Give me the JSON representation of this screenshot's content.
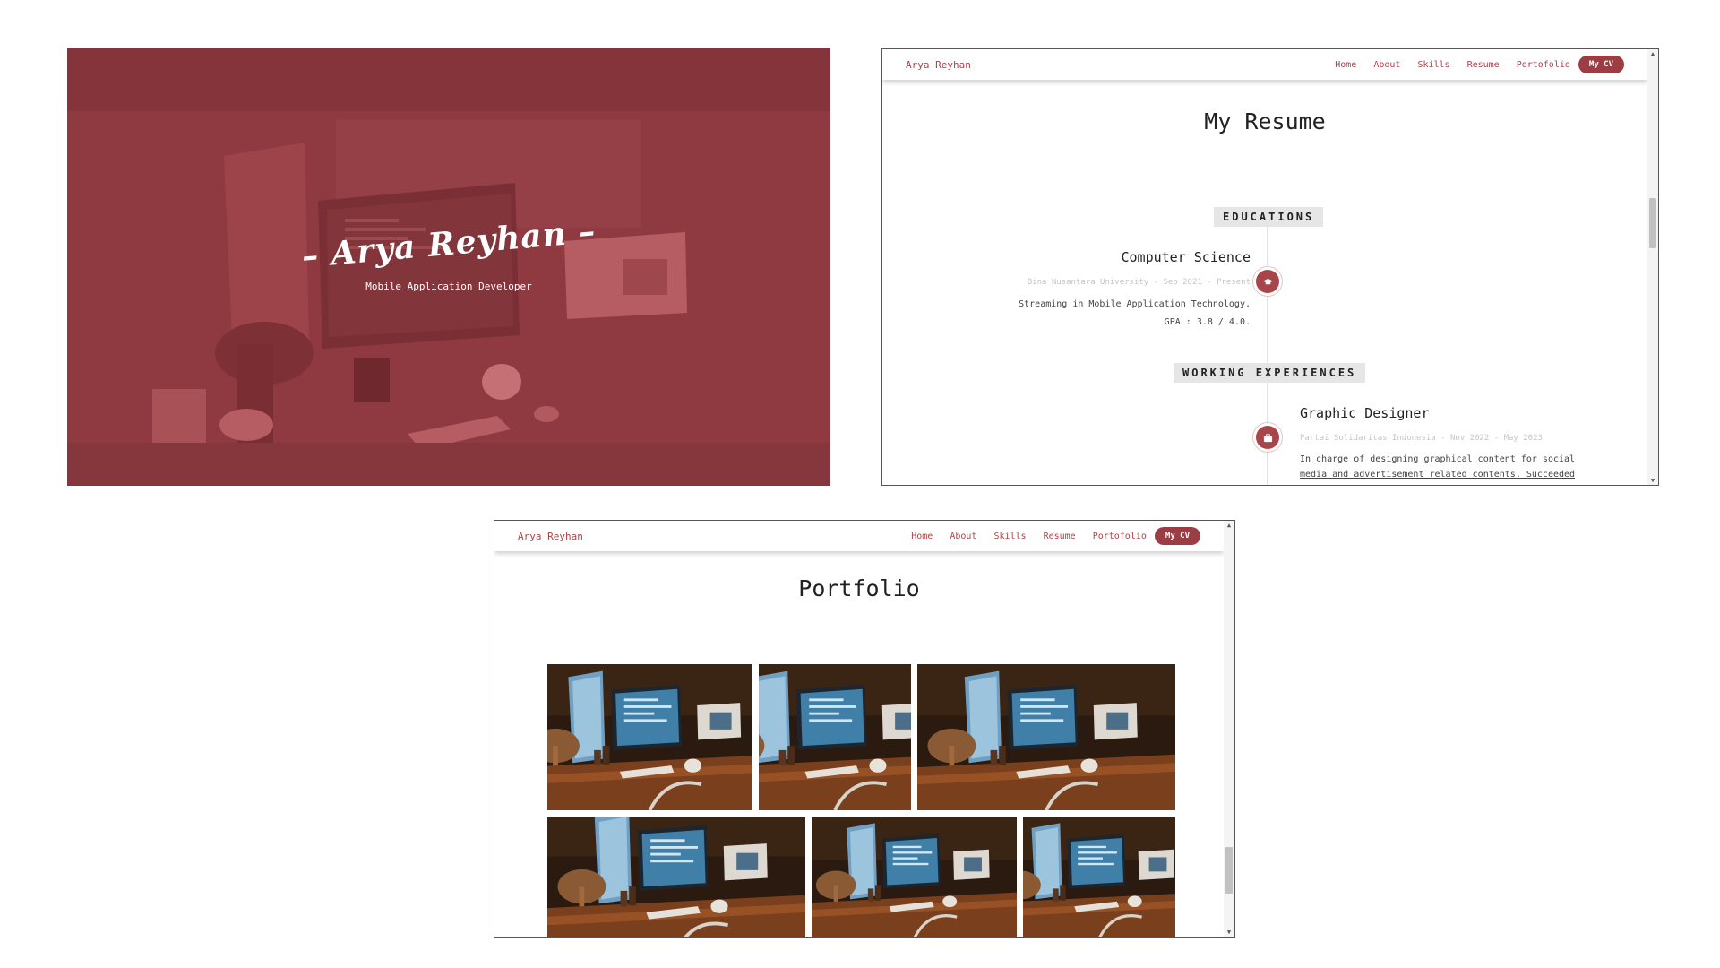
{
  "hero": {
    "title": "– Arya Reyhan –",
    "subtitle": "Mobile Application Developer",
    "overlay_color": "#8f3a41"
  },
  "nav": {
    "brand": "Arya Reyhan",
    "links": [
      "Home",
      "About",
      "Skills",
      "Resume",
      "Portofolio"
    ],
    "cv_button": "My CV",
    "accent_color": "#a8454b"
  },
  "resume": {
    "title": "My Resume",
    "educations": {
      "heading": "EDUCATIONS",
      "item": {
        "title": "Computer Science",
        "meta": "Bina Nusantara University - Sep 2021 - Present",
        "desc_line1": "Streaming in Mobile Application Technology.",
        "desc_line2": "GPA : 3.8 / 4.0.",
        "icon": "graduation-cap-icon"
      }
    },
    "experiences": {
      "heading": "WORKING EXPERIENCES",
      "item": {
        "title": "Graphic Designer",
        "meta": "Partai Solidaritas Indonesia - Nov 2022 - May 2023",
        "desc_line1": "In charge of designing graphical content for social",
        "desc_line2": "media and advertisement related contents. Succeeded",
        "icon": "briefcase-icon"
      }
    }
  },
  "portfolio": {
    "title": "Portfolio",
    "images": [
      "desk-setup-photo",
      "desk-setup-photo",
      "desk-setup-photo",
      "desk-setup-photo",
      "desk-setup-photo",
      "desk-setup-photo"
    ]
  }
}
